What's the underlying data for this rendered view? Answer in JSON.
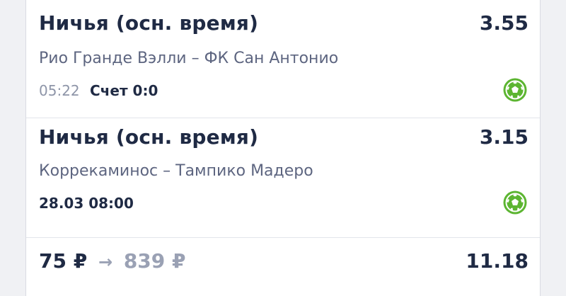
{
  "bets": [
    {
      "market": "Ничья (осн. время)",
      "odds": "3.55",
      "teams": "Рио Гранде Вэлли – ФК Сан Антонио",
      "time": "05:22",
      "score": "Счет 0:0",
      "sport_icon": "soccer-ball-icon"
    },
    {
      "market": "Ничья (осн. время)",
      "odds": "3.15",
      "teams": "Коррекаминос – Тампико Мадеро",
      "date": "28.03 08:00",
      "sport_icon": "soccer-ball-icon"
    }
  ],
  "footer": {
    "stake": "75 ₽",
    "arrow": "→",
    "payout": "839 ₽",
    "total_odds": "11.18"
  },
  "colors": {
    "text_primary": "#1f2a44",
    "text_secondary": "#5d6580",
    "text_muted": "#9aa1b4",
    "sport_icon": "#5cb531"
  }
}
